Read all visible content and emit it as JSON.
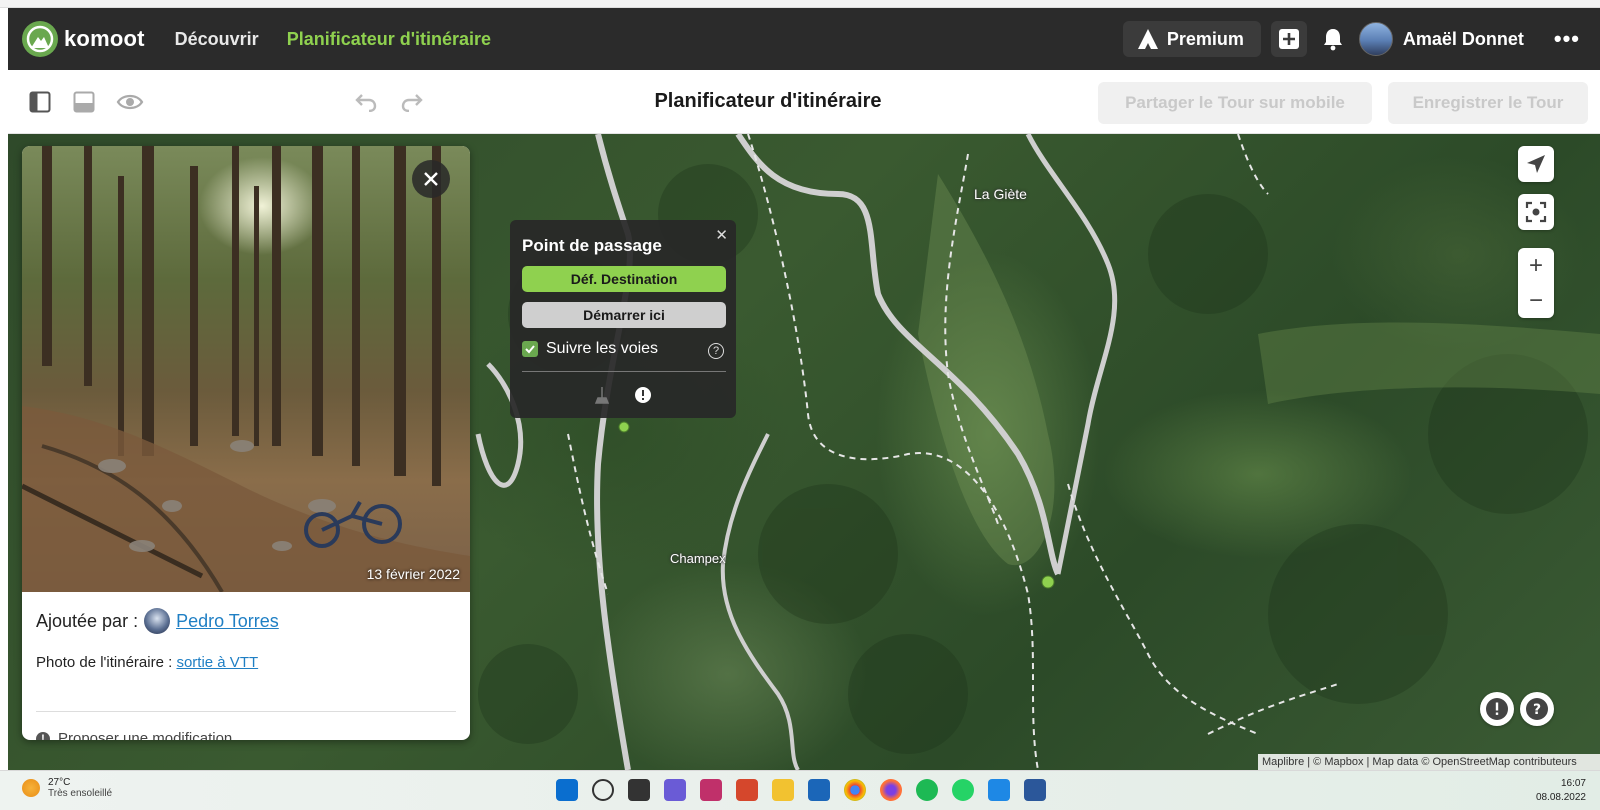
{
  "header": {
    "brand": "komoot",
    "nav": [
      {
        "label": "Découvrir"
      },
      {
        "label": "Planificateur d'itinéraire"
      }
    ],
    "premium_label": "Premium",
    "user_name": "Amaël Donnet"
  },
  "toolbar": {
    "title": "Planificateur d'itinéraire",
    "share_label": "Partager le Tour sur mobile",
    "save_label": "Enregistrer le Tour"
  },
  "photo_card": {
    "date": "13 février 2022",
    "added_by_label": "Ajoutée par :",
    "author": "Pedro Torres",
    "route_photo_label": "Photo de l'itinéraire :",
    "route_link": "sortie à VTT",
    "propose_label": "Proposer une modification"
  },
  "waypoint": {
    "title": "Point de passage",
    "destination_label": "Déf. Destination",
    "start_label": "Démarrer ici",
    "follow_label": "Suivre les voies",
    "follow_checked": true
  },
  "map": {
    "labels": [
      {
        "text": "La Giète"
      },
      {
        "text": "Champex"
      }
    ],
    "attribution": "Maplibre | © Mapbox | Map data © OpenStreetMap contributeurs"
  },
  "taskbar": {
    "temperature": "27°C",
    "weather": "Très ensoleillé",
    "time": "16:07",
    "date": "08.08.2022"
  },
  "colors": {
    "accent_green": "#8fd14f",
    "header_bg": "#2b2b2b",
    "link_blue": "#1f7fc4"
  }
}
